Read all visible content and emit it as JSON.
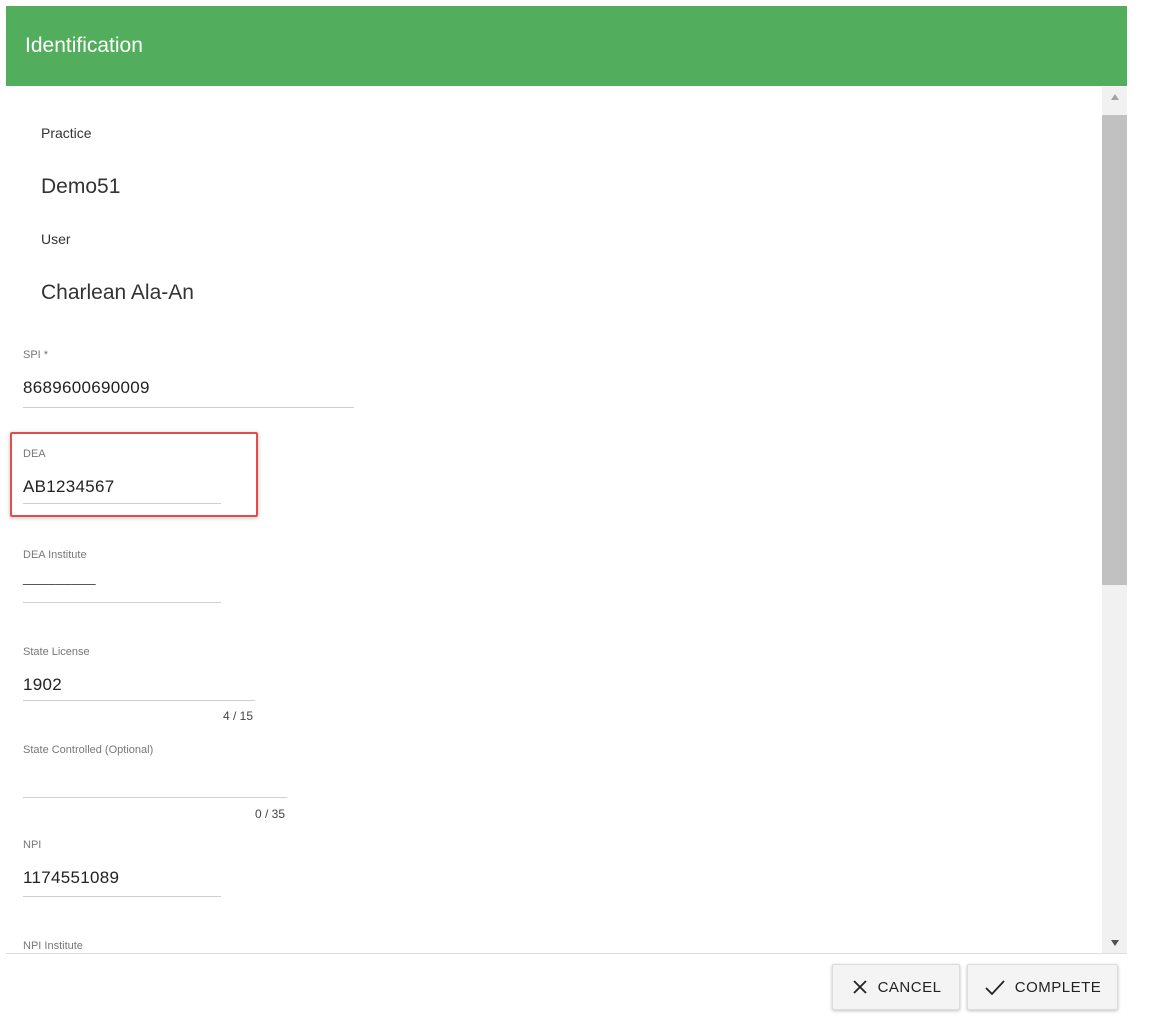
{
  "dialog": {
    "title": "Identification"
  },
  "practice": {
    "label": "Practice",
    "value": "Demo51"
  },
  "user": {
    "label": "User",
    "value": "Charlean Ala-An"
  },
  "fields": {
    "spi": {
      "label": "SPI *",
      "value": "8689600690009"
    },
    "dea": {
      "label": "DEA",
      "value": "AB1234567"
    },
    "dea_institute": {
      "label": "DEA Institute",
      "value": "_________"
    },
    "state_license": {
      "label": "State License",
      "value": "1902",
      "counter": "4 / 15"
    },
    "state_controlled": {
      "label": "State Controlled (Optional)",
      "value": "",
      "counter": "0 / 35"
    },
    "npi": {
      "label": "NPI",
      "value": "1174551089"
    },
    "npi_institute": {
      "label": "NPI Institute"
    }
  },
  "footer": {
    "cancel_label": "CANCEL",
    "complete_label": "COMPLETE"
  },
  "icons": {
    "cancel": "close-icon",
    "complete": "check-icon"
  },
  "colors": {
    "header": "#52ae5d",
    "highlight": "#e44c4a"
  }
}
